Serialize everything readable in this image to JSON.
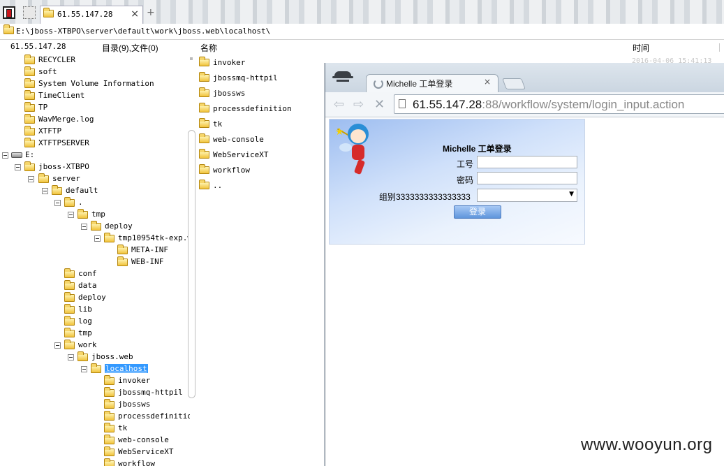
{
  "tabbar": {
    "active_tab_title": "61.55.147.28",
    "close_glyph": "×",
    "new_tab_glyph": "+"
  },
  "pathbar": {
    "path": "E:\\jboss-XTBPO\\server\\default\\work\\jboss.web\\localhost\\"
  },
  "header": {
    "host": "61.55.147.28",
    "count": "目录(9),文件(0)",
    "col_name": "名称",
    "col_time": "时间"
  },
  "tree": [
    {
      "label": "RECYCLER"
    },
    {
      "label": "soft"
    },
    {
      "label": "System Volume Information"
    },
    {
      "label": "TimeClient"
    },
    {
      "label": "TP"
    },
    {
      "label": "WavMerge.log"
    },
    {
      "label": "XTFTP"
    },
    {
      "label": "XTFTPSERVER"
    },
    {
      "label": "E:"
    },
    {
      "label": "jboss-XTBPO"
    },
    {
      "label": "server"
    },
    {
      "label": "default"
    },
    {
      "label": "."
    },
    {
      "label": "tmp"
    },
    {
      "label": "deploy"
    },
    {
      "label": "tmp10954tk-exp.w"
    },
    {
      "label": "META-INF"
    },
    {
      "label": "WEB-INF"
    },
    {
      "label": "conf"
    },
    {
      "label": "data"
    },
    {
      "label": "deploy"
    },
    {
      "label": "lib"
    },
    {
      "label": "log"
    },
    {
      "label": "tmp"
    },
    {
      "label": "work"
    },
    {
      "label": "jboss.web"
    },
    {
      "label": "localhost"
    },
    {
      "label": "invoker"
    },
    {
      "label": "jbossmq-httpil"
    },
    {
      "label": "jbossws"
    },
    {
      "label": "processdefinitio"
    },
    {
      "label": "tk"
    },
    {
      "label": "web-console"
    },
    {
      "label": "WebServiceXT"
    },
    {
      "label": "workflow"
    }
  ],
  "list": [
    {
      "label": "invoker"
    },
    {
      "label": "jbossmq-httpil"
    },
    {
      "label": "jbossws"
    },
    {
      "label": "processdefinition"
    },
    {
      "label": "tk"
    },
    {
      "label": "web-console"
    },
    {
      "label": "WebServiceXT"
    },
    {
      "label": "workflow"
    },
    {
      "label": ".."
    }
  ],
  "time_partial": "2016-04-06 15:41:13",
  "browser": {
    "tab_title": "Michelle 工单登录",
    "tab_close": "×",
    "back_glyph": "⇦",
    "forward_glyph": "⇨",
    "stop_glyph": "✕",
    "url_host": "61.55.147.28",
    "url_rest": ":88/workflow/system/login_input.action"
  },
  "login": {
    "title": "Michelle 工单登录",
    "id_label": "工号",
    "pw_label": "密码",
    "group_label": "组别3333333333333333",
    "id_value": "",
    "pw_value": "",
    "select_arrow": "▼",
    "button_label": "登录"
  },
  "watermark": "www.wooyun.org"
}
